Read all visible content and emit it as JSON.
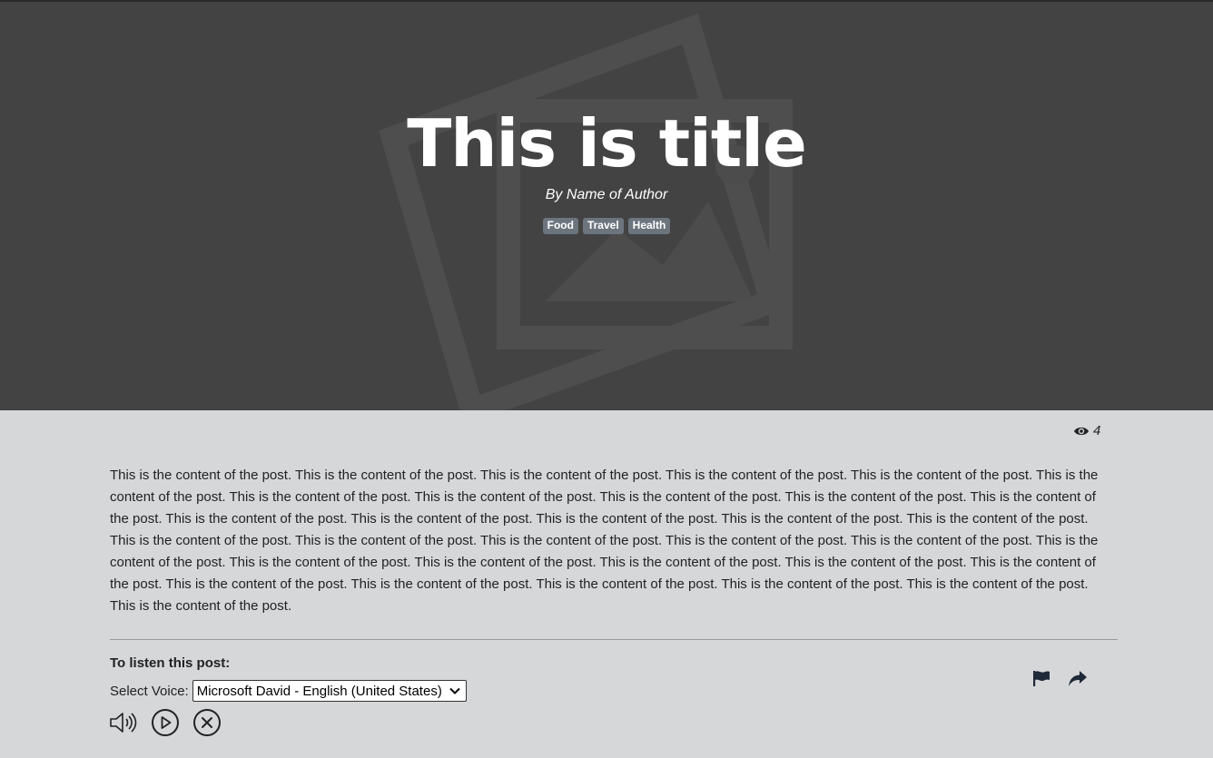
{
  "hero": {
    "title": "This is title",
    "author": "By Name of Author",
    "tags": [
      "Food",
      "Travel",
      "Health"
    ]
  },
  "stats": {
    "views": "4",
    "views_icon": "eye-icon"
  },
  "post": {
    "content": "This is the content of the post. This is the content of the post. This is the content of the post. This is the content of the post. This is the content of the post. This is the content of the post. This is the content of the post. This is the content of the post. This is the content of the post. This is the content of the post. This is the content of the post. This is the content of the post. This is the content of the post. This is the content of the post. This is the content of the post. This is the content of the post. This is the content of the post. This is the content of the post. This is the content of the post. This is the content of the post. This is the content of the post. This is the content of the post. This is the content of the post. This is the content of the post. This is the content of the post. This is the content of the post. This is the content of the post. This is the content of the post. This is the content of the post. This is the content of the post. This is the content of the post. This is the content of the post. This is the content of the post."
  },
  "listen": {
    "title": "To listen this post:",
    "voice_label": "Select Voice:",
    "voice_selected": "Microsoft David - English (United States)",
    "controls": [
      "volume-icon",
      "play-icon",
      "close-icon"
    ]
  },
  "actions": [
    "flag-icon",
    "share-icon"
  ],
  "colors": {
    "hero_bg": "#434343",
    "page_bg": "#d6d7d9",
    "tag_bg": "#6c757d",
    "text": "#222222"
  }
}
